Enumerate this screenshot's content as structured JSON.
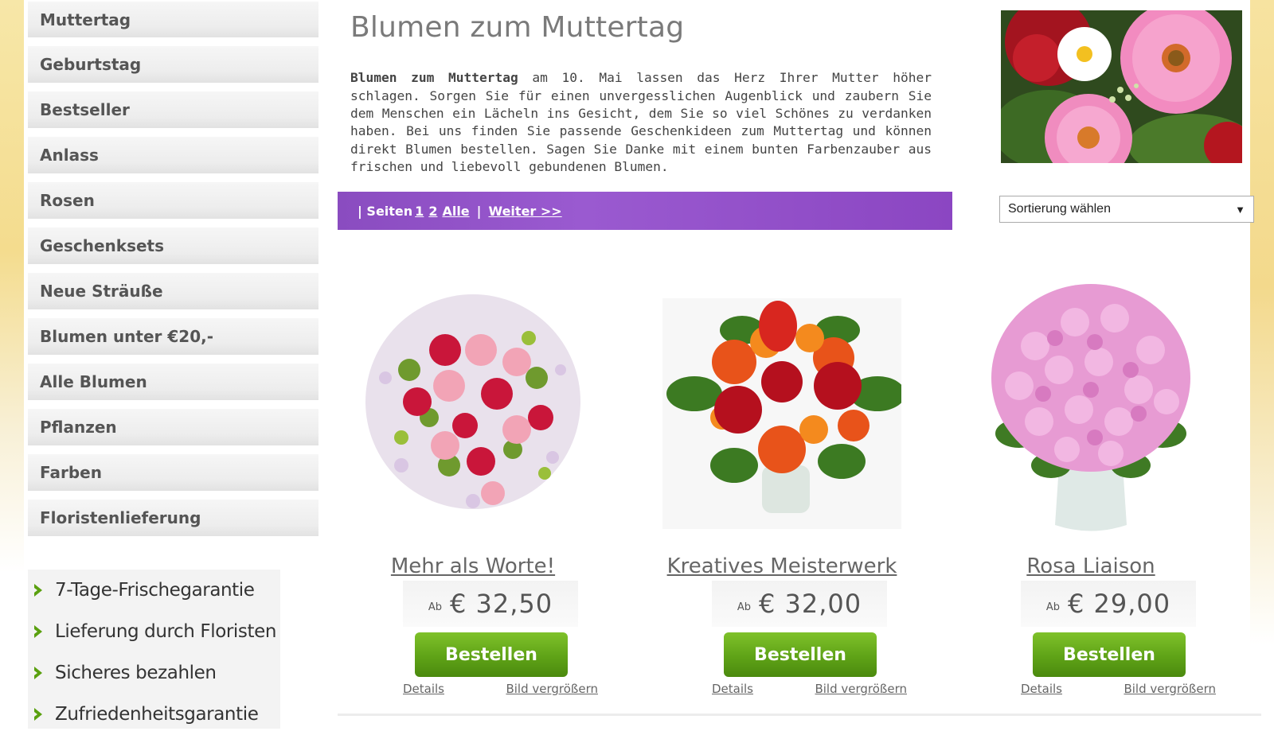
{
  "sidebar": {
    "items": [
      {
        "label": "Muttertag"
      },
      {
        "label": "Geburtstag"
      },
      {
        "label": "Bestseller"
      },
      {
        "label": "Anlass"
      },
      {
        "label": "Rosen"
      },
      {
        "label": "Geschenksets"
      },
      {
        "label": "Neue Sträuße"
      },
      {
        "label": "Blumen unter €20,-"
      },
      {
        "label": "Alle Blumen"
      },
      {
        "label": "Pflanzen"
      },
      {
        "label": "Farben"
      },
      {
        "label": "Floristenlieferung"
      }
    ]
  },
  "benefits": [
    {
      "label": "7-Tage-Frischegarantie"
    },
    {
      "label": "Lieferung durch Floristen"
    },
    {
      "label": "Sicheres bezahlen"
    },
    {
      "label": "Zufriedenheitsgarantie"
    }
  ],
  "main": {
    "title": "Blumen zum Muttertag",
    "intro_bold": "Blumen zum Muttertag",
    "intro_text": " am 10. Mai lassen das Herz Ihrer Mutter höher schlagen. Sorgen Sie für einen unvergesslichen Augenblick und zaubern Sie dem Menschen ein Lächeln ins Gesicht, dem Sie so viel Schönes zu verdanken haben. Bei uns finden Sie passende Geschenkideen zum Muttertag und können direkt Blumen bestellen. Sagen Sie Danke mit einem bunten Farbenzauber aus frischen und liebevoll gebundenen Blumen."
  },
  "pager": {
    "prefix": "| Seiten",
    "pages": [
      "1",
      "2"
    ],
    "all_label": "Alle",
    "divider": "|",
    "next_label": "Weiter >>"
  },
  "sort": {
    "selected": "Sortierung wählen",
    "arrow": "▼"
  },
  "products": [
    {
      "name": "Mehr als Worte!",
      "price_prefix": "Ab",
      "price": "€ 32,50",
      "order_label": "Bestellen",
      "details_label": "Details",
      "zoom_label": "Bild vergrößern"
    },
    {
      "name": "Kreatives Meisterwerk",
      "price_prefix": "Ab",
      "price": "€ 32,00",
      "order_label": "Bestellen",
      "details_label": "Details",
      "zoom_label": "Bild vergrößern"
    },
    {
      "name": "Rosa Liaison",
      "price_prefix": "Ab",
      "price": "€ 29,00",
      "order_label": "Bestellen",
      "details_label": "Details",
      "zoom_label": "Bild vergrößern"
    }
  ],
  "colors": {
    "pager_purple": "#8a4cc0",
    "order_green": "#5fa317",
    "nav_text": "#555555"
  }
}
